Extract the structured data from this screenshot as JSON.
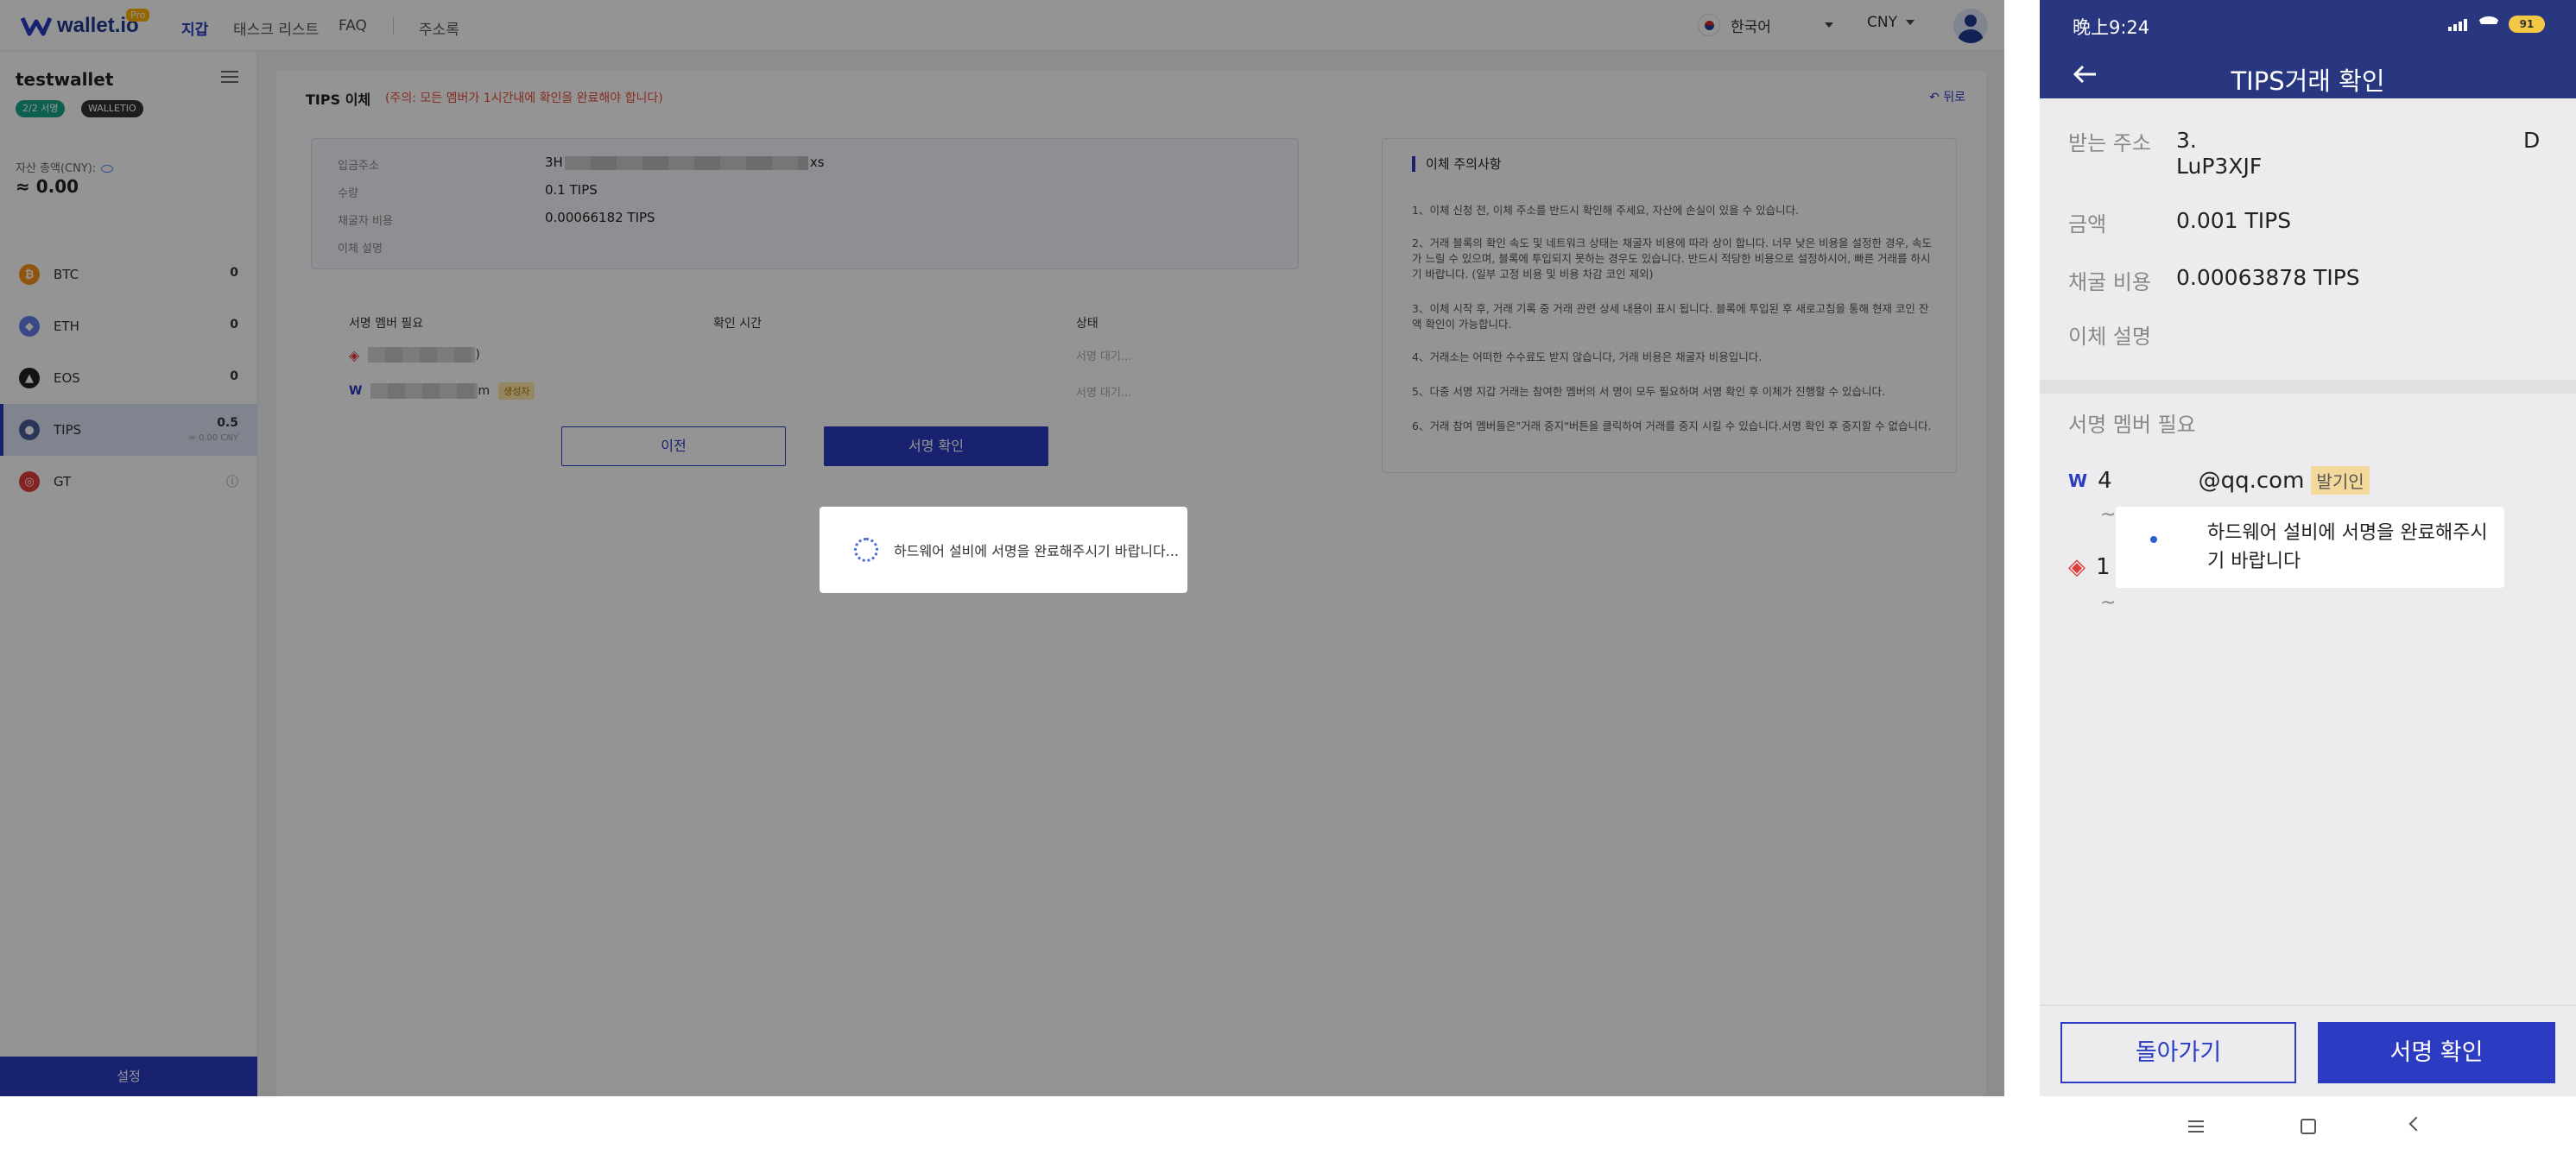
{
  "desktop": {
    "logo": {
      "text": "wallet.io",
      "pro": "Pro"
    },
    "nav": [
      {
        "label": "지갑"
      },
      {
        "label": "태스크 리스트"
      },
      {
        "label": "FAQ"
      },
      {
        "label": "주소록"
      }
    ],
    "language": "한국어",
    "currency": "CNY",
    "sidebar": {
      "wallet_name": "testwallet",
      "sig_badge": "2/2 서명",
      "walletio_badge": "WALLETIO",
      "asset_label": "자산 총액(CNY):",
      "asset_total": "≈ 0.00",
      "coins": [
        {
          "name": "BTC",
          "value": "0",
          "color": "#f7931a",
          "glyph": "₿"
        },
        {
          "name": "ETH",
          "value": "0",
          "color": "#627eea",
          "glyph": "◆"
        },
        {
          "name": "EOS",
          "value": "0",
          "color": "#222222",
          "glyph": "▲"
        },
        {
          "name": "TIPS",
          "value": "0.5",
          "sub": "≈ 0.00 CNY",
          "color": "#4a5c9c",
          "glyph": "●"
        },
        {
          "name": "GT",
          "value": "",
          "color": "#e03b3b",
          "glyph": "◎"
        }
      ],
      "settings": "설정"
    },
    "main": {
      "title": "TIPS 이체",
      "warning": "(주의: 모든 멤버가 1시간내에 확인을 완료해야 합니다)",
      "back": "뒤로",
      "info": {
        "address_label": "입금주소",
        "address_prefix": "3H",
        "address_suffix": "xs",
        "amount_label": "수량",
        "amount": "0.1 TIPS",
        "fee_label": "채굴자 비용",
        "fee": "0.00066182 TIPS",
        "memo_label": "이체 설명",
        "memo": ""
      },
      "table": {
        "headers": [
          "서명 멤버 필요",
          "확인 시간",
          "상태"
        ],
        "rows": [
          {
            "suffix": ")",
            "status": "서명 대기..."
          },
          {
            "suffix": "m",
            "tag": "생성자",
            "status": "서명 대기..."
          }
        ]
      },
      "btn_prev": "이전",
      "btn_confirm": "서명 확인",
      "notice": {
        "title": "이체 주의사항",
        "items": [
          "1、이체 신청 전, 이체 주소를 반드시 확인해 주세요, 자산에 손실이 있을 수 있습니다.",
          "2、거래 블록의 확인 속도 및 네트워크 상태는 채굴자 비용에 따라 상이 합니다. 너무 낮은 비용을 설정한 경우, 속도가 느릴 수 있으며, 블록에 투입되지 못하는 경우도 있습니다. 반드시 적당한 비용으로 설정하시어, 빠른 거래를 하시기 바랍니다. (일부 고정 비용 및 비용 차감 코인 제외)",
          "3、이체 시작 후, 거래 기록 중 거래 관련 상세 내용이 표시 됩니다. 블록에 투입된 후 새로고침을 통해 현재 코인 잔액 확인이 가능합니다.",
          "4、거래소는 어떠한 수수료도 받지 않습니다, 거래 비용은 채굴자 비용입니다.",
          "5、다중 서명 지갑 거래는 참여한 멤버의 서 명이 모두 필요하며 서명 확인 후 이체가 진행할 수 있습니다.",
          "6、거래 참여 멤버들은\"거래 중지\"버튼을 클릭하여 거래를 중지 시킬 수 있습니다.서명 확인 후 중지할 수 없습니다."
        ]
      }
    },
    "loading_text": "하드웨어 설비에 서명을 완료해주시기 바랍니다..."
  },
  "phone": {
    "time": "晚上9:24",
    "battery": "91",
    "title": "TIPS거래 확인",
    "details": {
      "address_label": "받는 주소",
      "address_line1": "3.",
      "address_line2": "LuP3XJF",
      "address_end": "D",
      "amount_label": "금액",
      "amount": "0.001 TIPS",
      "fee_label": "채굴 비용",
      "fee": "0.00063878 TIPS",
      "memo_label": "이체 설명"
    },
    "members_title": "서명 멤버 필요",
    "members": [
      {
        "id": "4",
        "email": "@qq.com",
        "tag": "발기인"
      },
      {
        "id": "1",
        "email": ""
      }
    ],
    "tilde": "~",
    "toast": "하드웨어 설비에 서명을 완료해주시기 바랍니다",
    "btn_back": "돌아가기",
    "btn_confirm": "서명 확인"
  }
}
